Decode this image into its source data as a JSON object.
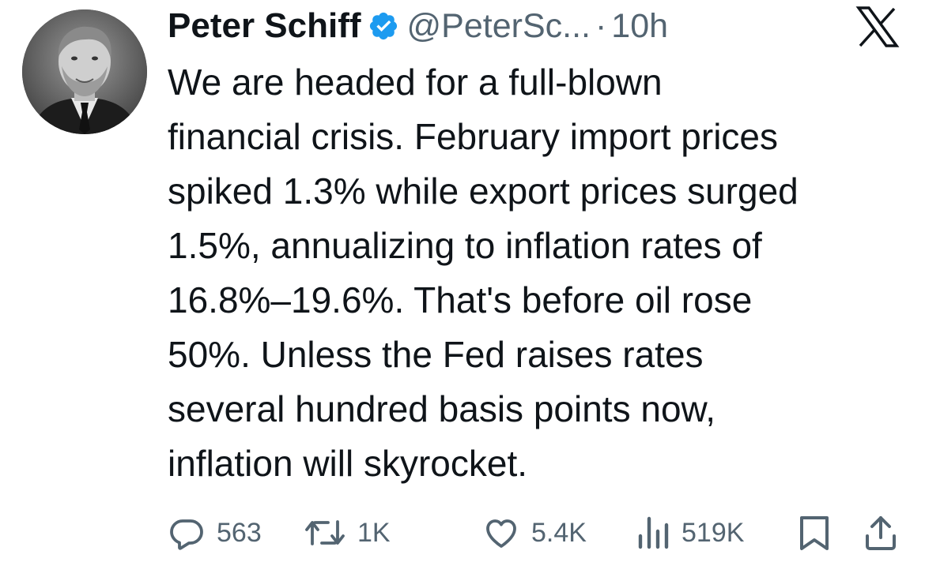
{
  "author": {
    "name": "Peter Schiff",
    "handle": "@PeterSc...",
    "separator": "·",
    "time": "10h",
    "verified": true
  },
  "platform_logo": "x-logo",
  "tweet": {
    "lines": [
      "We are headed for a full-blown",
      "financial crisis. February import prices",
      "spiked 1.3% while export prices surged",
      "1.5%, annualizing to inflation rates of",
      "16.8%–19.6%. That's before oil rose",
      "50%. Unless the Fed raises rates",
      "several hundred basis points now,",
      "inflation will skyrocket."
    ]
  },
  "actions": {
    "replies": "563",
    "reposts": "1K",
    "likes": "5.4K",
    "views": "519K",
    "icons": [
      "reply-icon",
      "repost-icon",
      "like-icon",
      "views-icon",
      "bookmark-icon",
      "share-icon"
    ]
  },
  "colors": {
    "text": "#0f1419",
    "secondary": "#536471",
    "verified": "#1d9bf0"
  }
}
